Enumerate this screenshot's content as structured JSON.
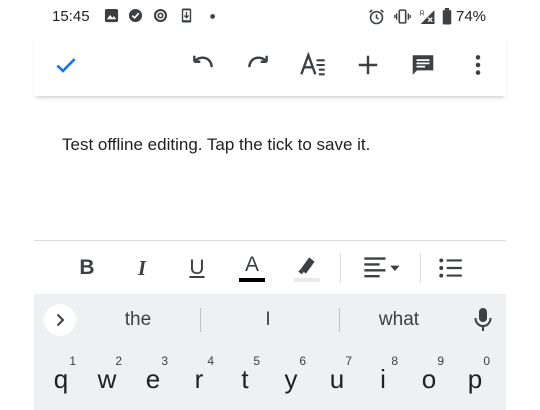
{
  "status_bar": {
    "time": "15:45",
    "battery": "74%",
    "left_icons": [
      "image-icon",
      "check-circle-icon",
      "cast-icon",
      "phone-download-icon",
      "dot-icon"
    ],
    "right_icons": [
      "alarm-icon",
      "vibrate-icon",
      "signal-icon",
      "battery-icon"
    ]
  },
  "toolbar": {
    "icons": [
      "check-icon",
      "undo-icon",
      "redo-icon",
      "text-format-icon",
      "add-icon",
      "comment-icon",
      "more-vert-icon"
    ],
    "accent_color": "#1a73e8"
  },
  "document": {
    "body_text": "Test offline editing. Tap the tick to save it."
  },
  "format_bar": {
    "bold": "B",
    "italic": "I",
    "underline": "U",
    "text_color": "A",
    "text_color_swatch": "#000000",
    "icons": [
      "highlight-icon",
      "align-left-icon",
      "bulleted-list-icon"
    ]
  },
  "suggestions": {
    "words": [
      "the",
      "I",
      "what"
    ]
  },
  "keyboard": {
    "row1": [
      {
        "letter": "q",
        "num": "1"
      },
      {
        "letter": "w",
        "num": "2"
      },
      {
        "letter": "e",
        "num": "3"
      },
      {
        "letter": "r",
        "num": "4"
      },
      {
        "letter": "t",
        "num": "5"
      },
      {
        "letter": "y",
        "num": "6"
      },
      {
        "letter": "u",
        "num": "7"
      },
      {
        "letter": "i",
        "num": "8"
      },
      {
        "letter": "o",
        "num": "9"
      },
      {
        "letter": "p",
        "num": "0"
      }
    ]
  }
}
